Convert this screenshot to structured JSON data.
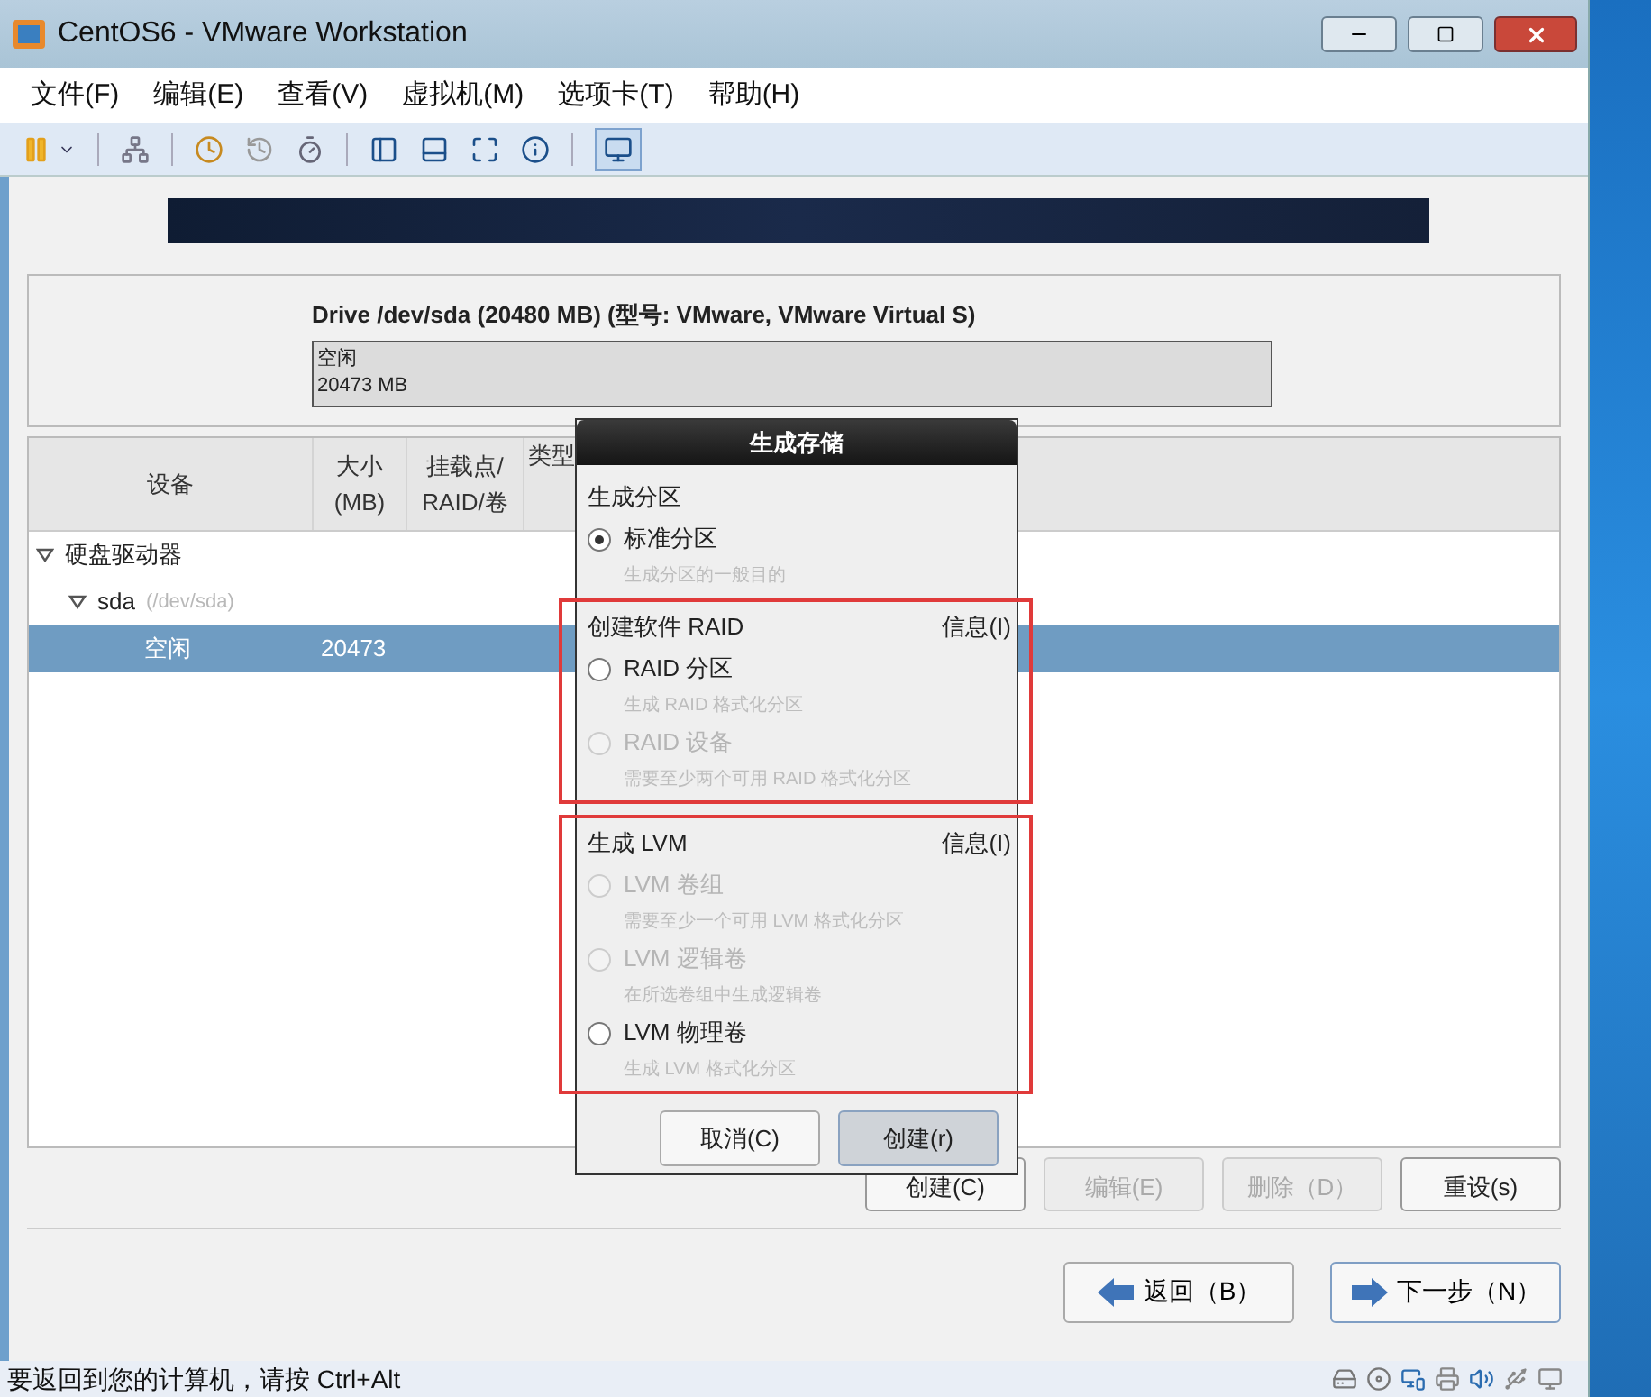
{
  "window": {
    "title": "CentOS6 - VMware Workstation"
  },
  "menu": [
    "文件(F)",
    "编辑(E)",
    "查看(V)",
    "虚拟机(M)",
    "选项卡(T)",
    "帮助(H)"
  ],
  "drive": {
    "title": "Drive /dev/sda (20480 MB) (型号: VMware, VMware Virtual S)",
    "bar_label": "空闲",
    "bar_size": "20473 MB"
  },
  "table": {
    "columns": [
      [
        "设备"
      ],
      [
        "大小",
        "(MB)"
      ],
      [
        "挂载点/",
        "RAID/卷"
      ],
      [
        "类型"
      ]
    ],
    "rows": [
      {
        "device": "硬盘驱动器",
        "expanded": true,
        "selected": false,
        "children": [
          {
            "device": "sda",
            "note": "(/dev/sda)",
            "expanded": true,
            "selected": false,
            "children": [
              {
                "device": "空闲",
                "size": "20473",
                "selected": true
              }
            ]
          }
        ]
      }
    ]
  },
  "actions": [
    {
      "label": "创建(C)",
      "disabled": false
    },
    {
      "label": "编辑(E)",
      "disabled": true
    },
    {
      "label": "删除（D）",
      "disabled": true
    },
    {
      "label": "重设(s)",
      "disabled": false
    }
  ],
  "nav": [
    {
      "label": "返回（B）",
      "kind": "back"
    },
    {
      "label": "下一步（N）",
      "kind": "next"
    }
  ],
  "dialog": {
    "title": "生成存储",
    "sections": [
      {
        "heading": "生成分区",
        "options": [
          {
            "label": "标准分区",
            "hint": "生成分区的一般目的",
            "selected": true,
            "disabled": false
          }
        ]
      },
      {
        "heading": "创建软件 RAID",
        "info": "信息(I)",
        "highlighted": true,
        "options": [
          {
            "label": "RAID 分区",
            "hint": "生成 RAID 格式化分区",
            "selected": false,
            "disabled": false
          },
          {
            "label": "RAID 设备",
            "hint": "需要至少两个可用 RAID 格式化分区",
            "selected": false,
            "disabled": true
          }
        ]
      },
      {
        "heading": "生成 LVM",
        "info": "信息(I)",
        "highlighted": true,
        "options": [
          {
            "label": "LVM 卷组",
            "hint": "需要至少一个可用 LVM 格式化分区",
            "selected": false,
            "disabled": true
          },
          {
            "label": "LVM 逻辑卷",
            "hint": "在所选卷组中生成逻辑卷",
            "selected": false,
            "disabled": true
          },
          {
            "label": "LVM 物理卷",
            "hint": "生成 LVM 格式化分区",
            "selected": false,
            "disabled": false
          }
        ]
      }
    ],
    "buttons": [
      {
        "label": "取消(C)",
        "focused": false
      },
      {
        "label": "创建(r)",
        "focused": true
      }
    ]
  },
  "status_bar": {
    "text": "要返回到您的计算机，请按 Ctrl+Alt"
  }
}
